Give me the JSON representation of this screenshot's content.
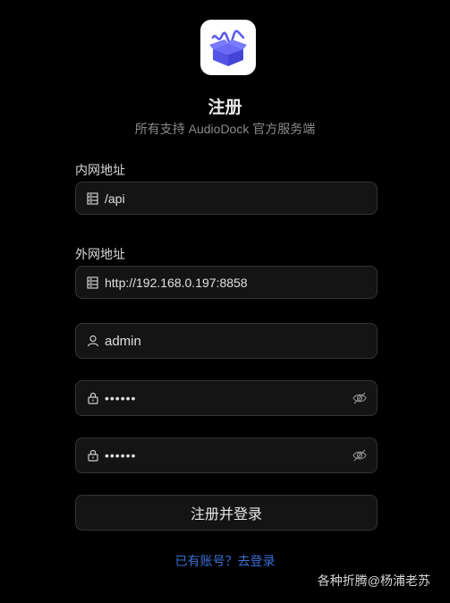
{
  "header": {
    "title": "注册",
    "subtitle": "所有支持 AudioDock 官方服务端"
  },
  "form": {
    "internal_label": "内网地址",
    "internal_value": "/api",
    "external_label": "外网地址",
    "external_value": "http://192.168.0.197:8858",
    "username_value": "admin",
    "password_value": "••••••",
    "confirm_password_value": "••••••",
    "submit_label": "注册并登录",
    "login_link": "已有账号？去登录"
  },
  "watermark": "各种折腾@杨浦老苏",
  "colors": {
    "background": "#000000",
    "accent": "#5b5bf0",
    "link": "#3b6fd6"
  },
  "icons": {
    "server": "server-icon",
    "user": "user-icon",
    "lock": "lock-icon",
    "eye_hidden": "eye-off-icon"
  }
}
